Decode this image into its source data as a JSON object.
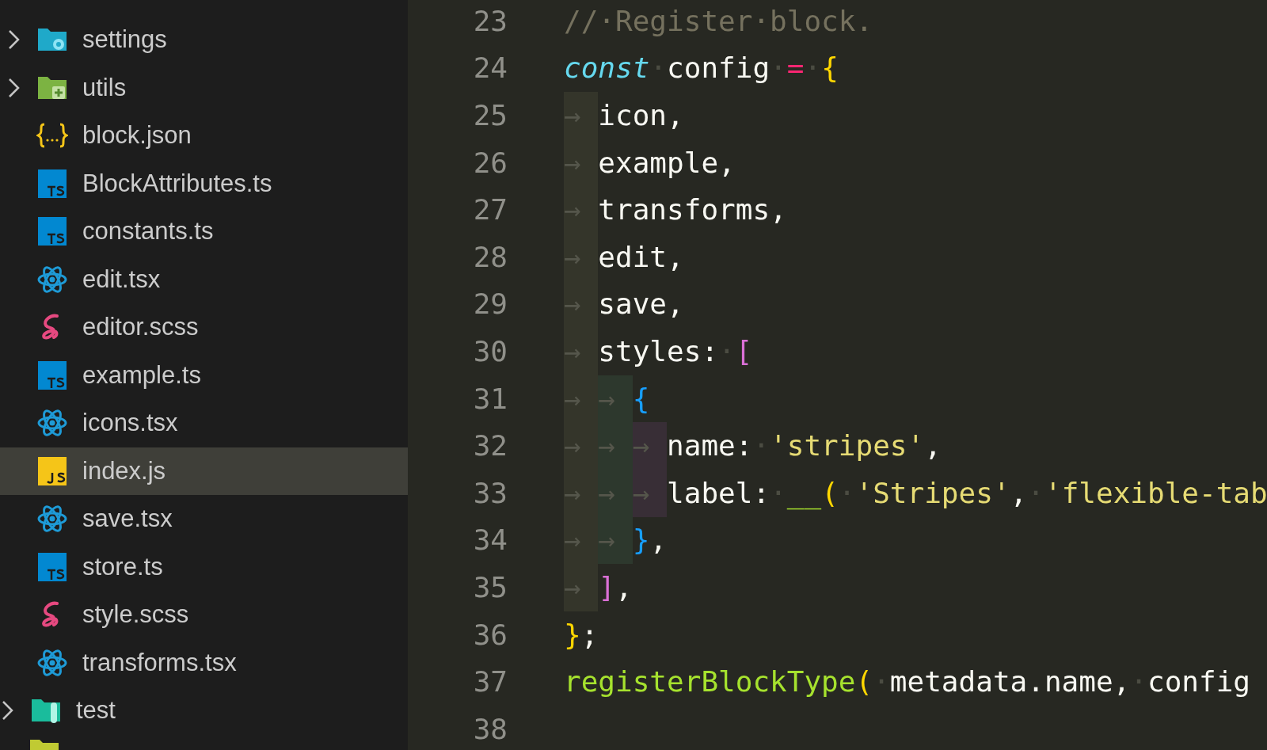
{
  "explorer": {
    "tree": [
      {
        "children": [
          {
            "label": "settings",
            "kind": "folder-settings",
            "expanded": false,
            "selected": false
          },
          {
            "label": "utils",
            "kind": "folder-utils",
            "expanded": false,
            "selected": false
          },
          {
            "label": "block.json",
            "kind": "json",
            "selected": false
          },
          {
            "label": "BlockAttributes.ts",
            "kind": "ts",
            "selected": false
          },
          {
            "label": "constants.ts",
            "kind": "ts",
            "selected": false
          },
          {
            "label": "edit.tsx",
            "kind": "react",
            "selected": false
          },
          {
            "label": "editor.scss",
            "kind": "sass",
            "selected": false
          },
          {
            "label": "example.ts",
            "kind": "ts",
            "selected": false
          },
          {
            "label": "icons.tsx",
            "kind": "react",
            "selected": false
          },
          {
            "label": "index.js",
            "kind": "js",
            "selected": true
          },
          {
            "label": "save.tsx",
            "kind": "react",
            "selected": false
          },
          {
            "label": "store.ts",
            "kind": "ts",
            "selected": false
          },
          {
            "label": "style.scss",
            "kind": "sass",
            "selected": false
          },
          {
            "label": "transforms.tsx",
            "kind": "react",
            "selected": false
          }
        ]
      },
      {
        "label": "test",
        "kind": "folder-test",
        "expanded": false,
        "selected": false
      },
      {
        "kind": "folder-plain",
        "selected": false
      }
    ]
  },
  "editor": {
    "lines": [
      {
        "number": "23",
        "tokens": [
          {
            "kind": "comment",
            "text": "//·Register·block."
          }
        ]
      },
      {
        "number": "24",
        "tokens": [
          {
            "kind": "keyword",
            "text": "const"
          },
          {
            "kind": "ws",
            "text": "·"
          },
          {
            "kind": "text",
            "text": "config"
          },
          {
            "kind": "ws",
            "text": "·"
          },
          {
            "kind": "op",
            "text": "="
          },
          {
            "kind": "ws",
            "text": "·"
          },
          {
            "kind": "bracket1",
            "text": "{"
          }
        ]
      },
      {
        "number": "25",
        "tokens": [
          {
            "kind": "tab",
            "text": "→"
          },
          {
            "kind": "text",
            "text": "icon,"
          }
        ]
      },
      {
        "number": "26",
        "tokens": [
          {
            "kind": "tab",
            "text": "→"
          },
          {
            "kind": "text",
            "text": "example,"
          }
        ]
      },
      {
        "number": "27",
        "tokens": [
          {
            "kind": "tab",
            "text": "→"
          },
          {
            "kind": "text",
            "text": "transforms,"
          }
        ]
      },
      {
        "number": "28",
        "tokens": [
          {
            "kind": "tab",
            "text": "→"
          },
          {
            "kind": "text",
            "text": "edit,"
          }
        ]
      },
      {
        "number": "29",
        "tokens": [
          {
            "kind": "tab",
            "text": "→"
          },
          {
            "kind": "text",
            "text": "save,"
          }
        ]
      },
      {
        "number": "30",
        "tokens": [
          {
            "kind": "tab",
            "text": "→"
          },
          {
            "kind": "text",
            "text": "styles:"
          },
          {
            "kind": "ws",
            "text": "·"
          },
          {
            "kind": "bracket2",
            "text": "["
          }
        ]
      },
      {
        "number": "31",
        "tokens": [
          {
            "kind": "tab",
            "text": "→"
          },
          {
            "kind": "tab",
            "text": "→"
          },
          {
            "kind": "bracket3",
            "text": "{"
          }
        ]
      },
      {
        "number": "32",
        "tokens": [
          {
            "kind": "tab",
            "text": "→"
          },
          {
            "kind": "tab",
            "text": "→"
          },
          {
            "kind": "tab",
            "text": "→"
          },
          {
            "kind": "text",
            "text": "name:"
          },
          {
            "kind": "ws",
            "text": "·"
          },
          {
            "kind": "string",
            "text": "'stripes'"
          },
          {
            "kind": "text",
            "text": ","
          }
        ]
      },
      {
        "number": "33",
        "tokens": [
          {
            "kind": "tab",
            "text": "→"
          },
          {
            "kind": "tab",
            "text": "→"
          },
          {
            "kind": "tab",
            "text": "→"
          },
          {
            "kind": "text",
            "text": "label:"
          },
          {
            "kind": "ws",
            "text": "·"
          },
          {
            "kind": "func",
            "text": "__"
          },
          {
            "kind": "bracket1",
            "text": "("
          },
          {
            "kind": "ws",
            "text": "·"
          },
          {
            "kind": "string",
            "text": "'Stripes'"
          },
          {
            "kind": "text",
            "text": ","
          },
          {
            "kind": "ws",
            "text": "·"
          },
          {
            "kind": "string",
            "text": "'flexible-tab"
          }
        ]
      },
      {
        "number": "34",
        "tokens": [
          {
            "kind": "tab",
            "text": "→"
          },
          {
            "kind": "tab",
            "text": "→"
          },
          {
            "kind": "bracket3",
            "text": "}"
          },
          {
            "kind": "text",
            "text": ","
          }
        ]
      },
      {
        "number": "35",
        "tokens": [
          {
            "kind": "tab",
            "text": "→"
          },
          {
            "kind": "bracket2",
            "text": "]"
          },
          {
            "kind": "text",
            "text": ","
          }
        ]
      },
      {
        "number": "36",
        "tokens": [
          {
            "kind": "bracket1",
            "text": "}"
          },
          {
            "kind": "text",
            "text": ";"
          }
        ]
      },
      {
        "number": "37",
        "tokens": [
          {
            "kind": "func",
            "text": "registerBlockType"
          },
          {
            "kind": "bracket1",
            "text": "("
          },
          {
            "kind": "ws",
            "text": "·"
          },
          {
            "kind": "text",
            "text": "metadata.name,"
          },
          {
            "kind": "ws",
            "text": "·"
          },
          {
            "kind": "text",
            "text": "config"
          }
        ]
      },
      {
        "number": "38"
      }
    ]
  }
}
